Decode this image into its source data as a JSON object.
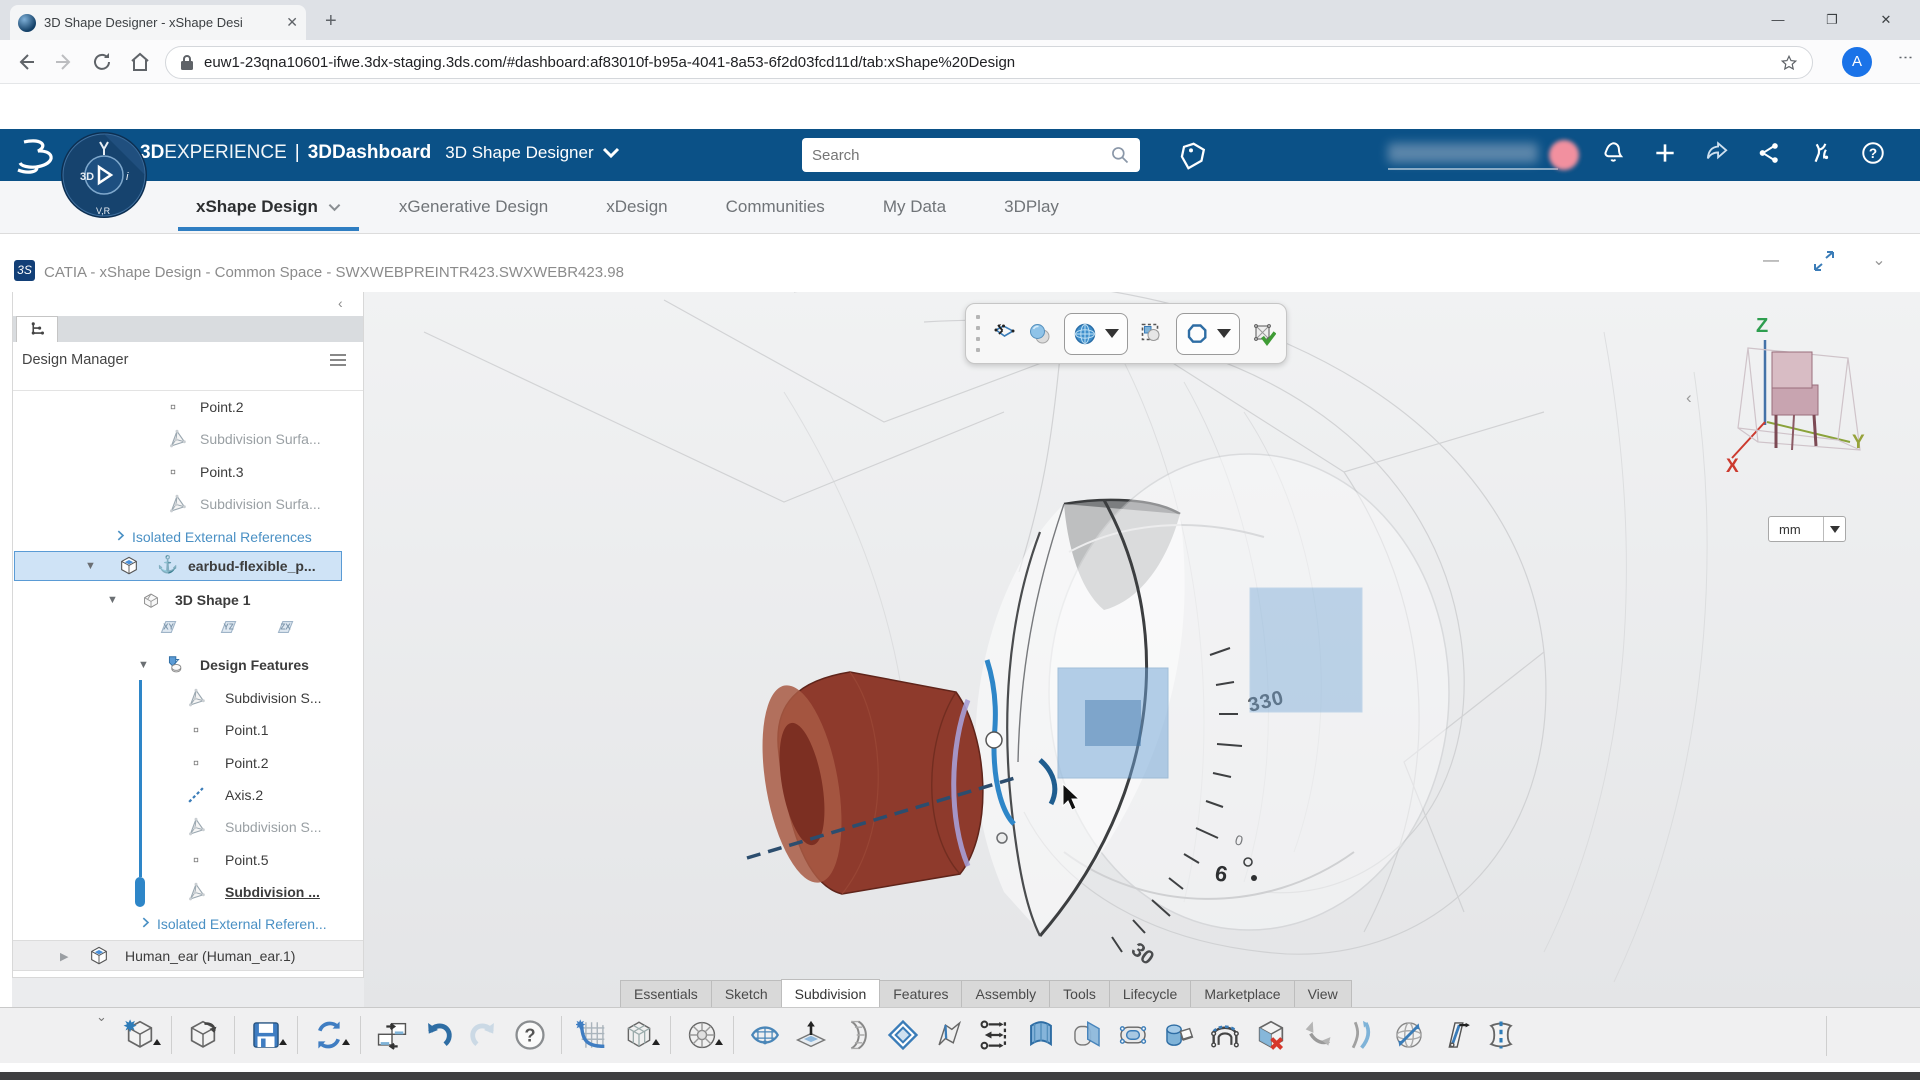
{
  "browser": {
    "tab_title": "3D Shape Designer - xShape Desi",
    "url": "euw1-23qna10601-ifwe.3dx-staging.3ds.com/#dashboard:af83010f-b95a-4041-8a53-6f2d03fcd11d/tab:xShape%20Design",
    "profile_initial": "A"
  },
  "header": {
    "brand_bold": "3D",
    "brand_light": "EXPERIENCE",
    "divider": "|",
    "dashboard": "3DDashboard",
    "app_name": "3D Shape Designer",
    "search_placeholder": "Search",
    "compass": {
      "left": "3D",
      "right": "i",
      "bottom": "V,R"
    },
    "right_icons": [
      "bell-icon",
      "plus-icon",
      "share-icon",
      "network-icon",
      "swym-icon",
      "help-icon"
    ]
  },
  "nav_tabs": [
    {
      "label": "xShape Design",
      "active": true,
      "caret": true
    },
    {
      "label": "xGenerative Design",
      "active": false
    },
    {
      "label": "xDesign",
      "active": false
    },
    {
      "label": "Communities",
      "active": false
    },
    {
      "label": "My Data",
      "active": false
    },
    {
      "label": "3DPlay",
      "active": false
    }
  ],
  "window": {
    "logo": "3S",
    "title": "CATIA - xShape Design - Common Space - SWXWEBPREINTR423.SWXWEBR423.98",
    "controls": [
      "minimize",
      "resize",
      "collapse"
    ]
  },
  "left_panel": {
    "title": "Design Manager",
    "tree": [
      {
        "label": "Point.2",
        "icon": "point"
      },
      {
        "label": "Subdivision Surfa...",
        "icon": "subdiv",
        "muted": true
      },
      {
        "label": "Point.3",
        "icon": "point"
      },
      {
        "label": "Subdivision Surfa...",
        "icon": "subdiv",
        "muted": true
      },
      {
        "label": "Isolated External References",
        "icon": "expand",
        "link": true
      },
      {
        "label": "earbud-flexible_p...",
        "icon": "product",
        "bold": true,
        "selected": true,
        "caret": "down",
        "anchor": true
      },
      {
        "label": "3D Shape 1",
        "icon": "shape",
        "bold": true,
        "caret": "down"
      },
      {
        "label": "",
        "icon": "planes",
        "planes": [
          "XY",
          "YZ",
          "ZX"
        ]
      },
      {
        "label": "Design Features",
        "icon": "features",
        "bold": true,
        "caret": "down"
      },
      {
        "label": "Subdivision S...",
        "icon": "subdiv"
      },
      {
        "label": "Point.1",
        "icon": "point"
      },
      {
        "label": "Point.2",
        "icon": "point"
      },
      {
        "label": "Axis.2",
        "icon": "axis"
      },
      {
        "label": "Subdivision S...",
        "icon": "subdiv",
        "muted": true
      },
      {
        "label": "Point.5",
        "icon": "point"
      },
      {
        "label": "Subdivision ...",
        "icon": "subdiv",
        "bold": true,
        "underline": true
      },
      {
        "label": "Isolated External Referen...",
        "icon": "expand",
        "link": true
      },
      {
        "label": "Human_ear (Human_ear.1)",
        "icon": "product",
        "caret": "right"
      }
    ]
  },
  "viewport": {
    "unit": "mm",
    "triad": {
      "x": "X",
      "y": "Y",
      "z": "Z"
    },
    "dial": {
      "main": "330",
      "low": "30",
      "six": "6",
      "zero": "0"
    },
    "float_toolbar": [
      "drag-handle",
      "subdivision-surface-icon",
      "spheres-icon",
      "sphere-mode-dropdown",
      "select-elements-icon",
      "polygon-mode-dropdown",
      "ok-button"
    ]
  },
  "bottom_tabs": [
    {
      "label": "Essentials"
    },
    {
      "label": "Sketch"
    },
    {
      "label": "Subdivision",
      "active": true
    },
    {
      "label": "Features"
    },
    {
      "label": "Assembly"
    },
    {
      "label": "Tools"
    },
    {
      "label": "Lifecycle"
    },
    {
      "label": "Marketplace"
    },
    {
      "label": "View"
    }
  ],
  "toolbar": {
    "items": [
      {
        "icon": "new",
        "name": "new-content-button",
        "dd": true
      },
      {
        "sep": true
      },
      {
        "icon": "open",
        "name": "open-content-button"
      },
      {
        "sep": true
      },
      {
        "icon": "save",
        "name": "save-button",
        "dd": true
      },
      {
        "sep": true
      },
      {
        "icon": "sync",
        "name": "refresh-button",
        "dd": true
      },
      {
        "sep": true
      },
      {
        "icon": "swap",
        "name": "swap-references-button"
      },
      {
        "icon": "undo",
        "name": "undo-button"
      },
      {
        "icon": "redo",
        "name": "redo-button",
        "disabled": true
      },
      {
        "icon": "helpc",
        "name": "help-button"
      },
      {
        "sep": true
      },
      {
        "icon": "grid",
        "name": "nurbs-grid-button"
      },
      {
        "icon": "sdcube",
        "name": "subdivision-box-button",
        "dd": true
      },
      {
        "sep": true
      },
      {
        "icon": "sdsphere",
        "name": "subdivision-sphere-button",
        "dd": true
      },
      {
        "sep": true
      },
      {
        "icon": "meshnet",
        "name": "mesh-surface-button"
      },
      {
        "icon": "extrude",
        "name": "extrude-face-button"
      },
      {
        "icon": "bendgrid",
        "name": "bend-sheet-button"
      },
      {
        "icon": "inset",
        "name": "inset-frame-button"
      },
      {
        "icon": "crease",
        "name": "crease-edge-button"
      },
      {
        "icon": "distrib",
        "name": "align-distribute-button"
      },
      {
        "icon": "panel",
        "name": "fill-panel-button"
      },
      {
        "icon": "cutplane",
        "name": "cut-with-plane-button"
      },
      {
        "icon": "tube",
        "name": "weld-tube-button"
      },
      {
        "icon": "cylcube",
        "name": "revolve-cylinder-button"
      },
      {
        "icon": "bridge",
        "name": "bridge-faces-button"
      },
      {
        "icon": "delface",
        "name": "delete-face-button"
      },
      {
        "icon": "unfold",
        "name": "unfold-surface-button"
      },
      {
        "icon": "cblend",
        "name": "curve-blend-button"
      },
      {
        "icon": "defsph",
        "name": "deform-sphere-button"
      },
      {
        "icon": "trim",
        "name": "trim-surface-button"
      },
      {
        "icon": "symm",
        "name": "symmetry-button"
      }
    ]
  }
}
